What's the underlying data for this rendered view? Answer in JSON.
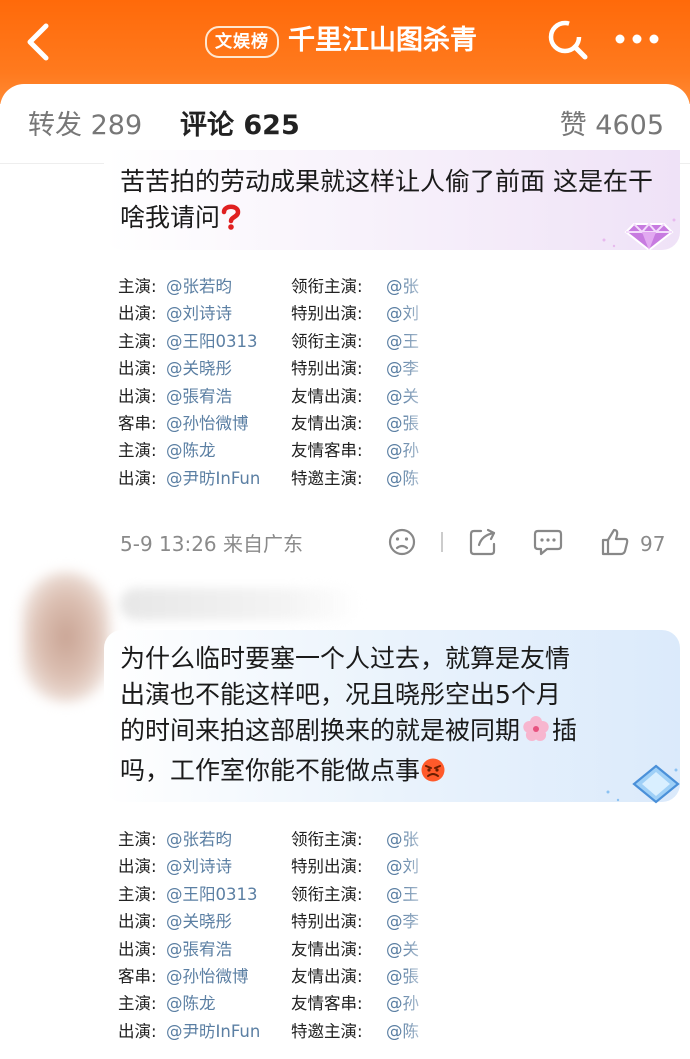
{
  "header": {
    "tag": "文娱榜",
    "title": "千里江山图杀青",
    "icons": [
      "chevron-left-icon",
      "search-icon",
      "more-icon"
    ]
  },
  "tabs": {
    "repost": "转发 289",
    "comment": "评论 625",
    "like": "赞 4605"
  },
  "comments": [
    {
      "text": "苦苦拍的劳动成果就这样让人偷了前面 这是在干啥我请问",
      "emoji": "red-question-mark-icon",
      "badge": "purple-diamond-badge-icon",
      "time_location": "5-9 13:26 来自广东",
      "like_count": "97",
      "actions": [
        "dislike-icon",
        "share-icon",
        "comment-icon",
        "thumbs-up-icon"
      ]
    },
    {
      "text_lines": [
        "为什么临时要塞一个人过去，就算是友情",
        "出演也不能这样吧，况且晓彤空出5个月",
        "的时间来拍这部剧换来的就是被同期",
        "插",
        "吗，工作室你能不能做点事"
      ],
      "emojis": [
        "cherry-blossom-icon",
        "angry-face-icon"
      ],
      "badge": "blue-diamond-badge-icon"
    }
  ],
  "cast_list": [
    {
      "role1": "主演:",
      "name1": "@张若昀",
      "role2": "领衔主演:",
      "name2": "@张"
    },
    {
      "role1": "出演:",
      "name1": "@刘诗诗",
      "role2": "特别出演:",
      "name2": "@刘"
    },
    {
      "role1": "主演:",
      "name1": "@王阳0313",
      "role2": "领衔主演:",
      "name2": "@王"
    },
    {
      "role1": "出演:",
      "name1": "@关晓彤",
      "role2": "特别出演:",
      "name2": "@李"
    },
    {
      "role1": "出演:",
      "name1": "@張宥浩",
      "role2": "友情出演:",
      "name2": "@关"
    },
    {
      "role1": "客串:",
      "name1": "@孙怡微博",
      "role2": "友情出演:",
      "name2": "@張"
    },
    {
      "role1": "主演:",
      "name1": "@陈龙",
      "role2": "友情客串:",
      "name2": "@孙"
    },
    {
      "role1": "出演:",
      "name1": "@尹昉InFun",
      "role2": "特邀主演:",
      "name2": "@陈"
    }
  ],
  "colors": {
    "header_bg": "#ff6a0a",
    "tab_accent": "#ff8a00",
    "cast_name": "#5b7fa3"
  }
}
